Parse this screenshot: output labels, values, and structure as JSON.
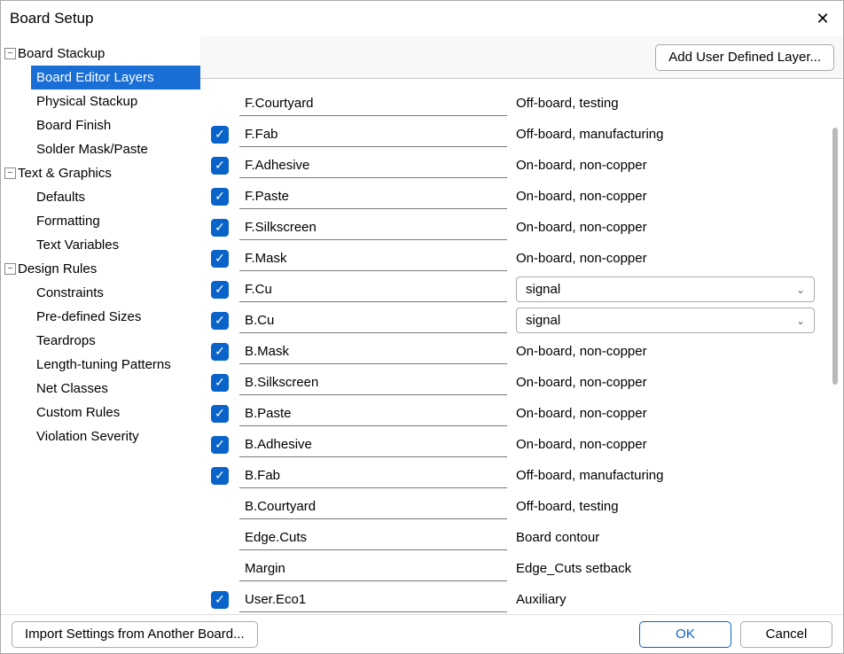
{
  "window": {
    "title": "Board Setup"
  },
  "toolbar": {
    "add_user_layer": "Add User Defined Layer..."
  },
  "footer": {
    "import": "Import Settings from Another Board...",
    "ok": "OK",
    "cancel": "Cancel"
  },
  "tree": {
    "groups": [
      {
        "label": "Board Stackup",
        "items": [
          {
            "label": "Board Editor Layers",
            "selected": true
          },
          {
            "label": "Physical Stackup"
          },
          {
            "label": "Board Finish"
          },
          {
            "label": "Solder Mask/Paste"
          }
        ]
      },
      {
        "label": "Text & Graphics",
        "items": [
          {
            "label": "Defaults"
          },
          {
            "label": "Formatting"
          },
          {
            "label": "Text Variables"
          }
        ]
      },
      {
        "label": "Design Rules",
        "items": [
          {
            "label": "Constraints"
          },
          {
            "label": "Pre-defined Sizes"
          },
          {
            "label": "Teardrops"
          },
          {
            "label": "Length-tuning Patterns"
          },
          {
            "label": "Net Classes"
          },
          {
            "label": "Custom Rules"
          },
          {
            "label": "Violation Severity"
          }
        ]
      }
    ]
  },
  "layers": [
    {
      "checked": false,
      "name": "F.Courtyard",
      "type": "Off-board, testing",
      "kind": "text"
    },
    {
      "checked": true,
      "name": "F.Fab",
      "type": "Off-board, manufacturing",
      "kind": "text"
    },
    {
      "checked": true,
      "name": "F.Adhesive",
      "type": "On-board, non-copper",
      "kind": "text"
    },
    {
      "checked": true,
      "name": "F.Paste",
      "type": "On-board, non-copper",
      "kind": "text"
    },
    {
      "checked": true,
      "name": "F.Silkscreen",
      "type": "On-board, non-copper",
      "kind": "text"
    },
    {
      "checked": true,
      "name": "F.Mask",
      "type": "On-board, non-copper",
      "kind": "text"
    },
    {
      "checked": true,
      "name": "F.Cu",
      "type": "signal",
      "kind": "select"
    },
    {
      "checked": true,
      "name": "B.Cu",
      "type": "signal",
      "kind": "select"
    },
    {
      "checked": true,
      "name": "B.Mask",
      "type": "On-board, non-copper",
      "kind": "text"
    },
    {
      "checked": true,
      "name": "B.Silkscreen",
      "type": "On-board, non-copper",
      "kind": "text"
    },
    {
      "checked": true,
      "name": "B.Paste",
      "type": "On-board, non-copper",
      "kind": "text"
    },
    {
      "checked": true,
      "name": "B.Adhesive",
      "type": "On-board, non-copper",
      "kind": "text"
    },
    {
      "checked": true,
      "name": "B.Fab",
      "type": "Off-board, manufacturing",
      "kind": "text"
    },
    {
      "checked": false,
      "name": "B.Courtyard",
      "type": "Off-board, testing",
      "kind": "text"
    },
    {
      "checked": false,
      "name": "Edge.Cuts",
      "type": "Board contour",
      "kind": "text"
    },
    {
      "checked": false,
      "name": "Margin",
      "type": "Edge_Cuts setback",
      "kind": "text"
    },
    {
      "checked": true,
      "name": "User.Eco1",
      "type": "Auxiliary",
      "kind": "text"
    }
  ]
}
